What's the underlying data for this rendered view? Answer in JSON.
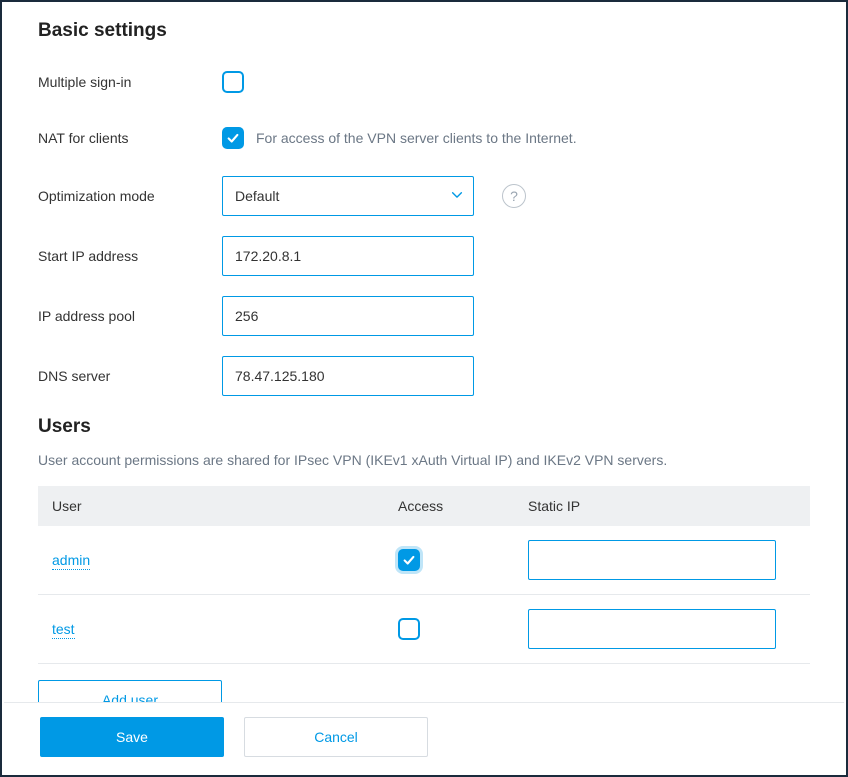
{
  "basic": {
    "title": "Basic settings",
    "multiple_signin_label": "Multiple sign-in",
    "multiple_signin_checked": false,
    "nat_label": "NAT for clients",
    "nat_checked": true,
    "nat_hint": "For access of the VPN server clients to the Internet.",
    "optimization_label": "Optimization mode",
    "optimization_value": "Default",
    "start_ip_label": "Start IP address",
    "start_ip_value": "172.20.8.1",
    "pool_label": "IP address pool",
    "pool_value": "256",
    "dns_label": "DNS server",
    "dns_value": "78.47.125.180",
    "help_glyph": "?"
  },
  "users": {
    "title": "Users",
    "description": "User account permissions are shared for IPsec VPN (IKEv1 xAuth Virtual IP) and IKEv2 VPN servers.",
    "columns": {
      "user": "User",
      "access": "Access",
      "static_ip": "Static IP"
    },
    "rows": [
      {
        "name": "admin",
        "access": true,
        "static_ip": ""
      },
      {
        "name": "test",
        "access": false,
        "static_ip": ""
      }
    ],
    "add_user_label": "Add user"
  },
  "footer": {
    "save": "Save",
    "cancel": "Cancel"
  }
}
